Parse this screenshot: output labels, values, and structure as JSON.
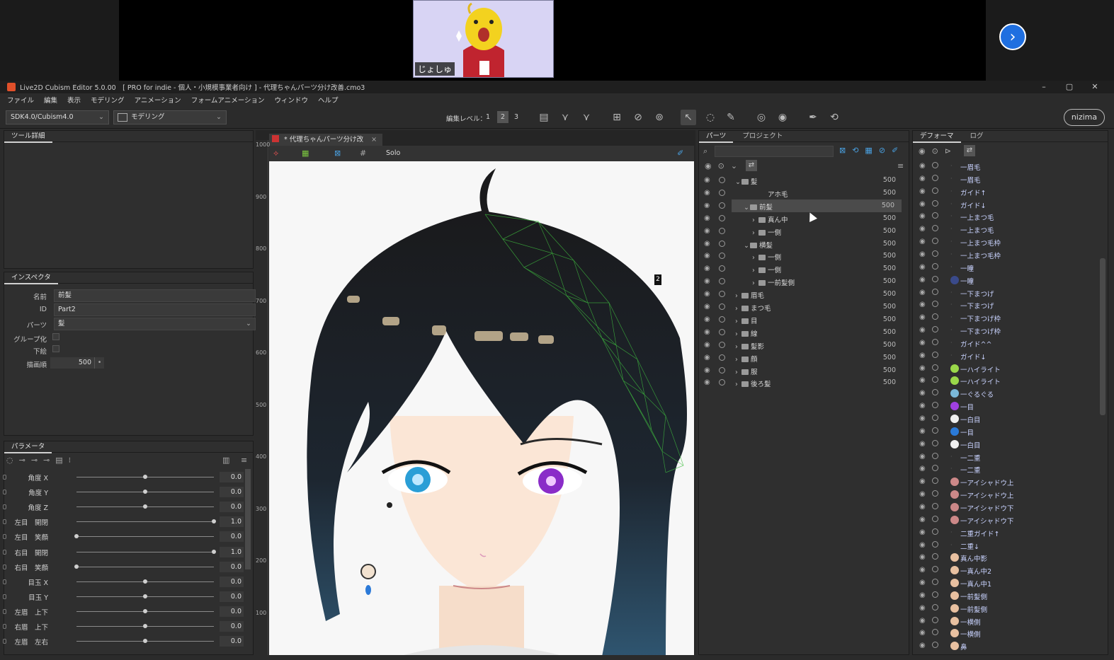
{
  "stream": {
    "webcam_name": "じょしゅ",
    "next_icon": "chevron-right-icon"
  },
  "window": {
    "title": "Live2D Cubism Editor 5.0.00　[ PRO for indie - 個人・小規模事業者向け ] - 代理ちゃんパーツ分け改善.cmo3",
    "minimize": "–",
    "restore": "▢",
    "close": "✕"
  },
  "menu": [
    "ファイル",
    "編集",
    "表示",
    "モデリング",
    "アニメーション",
    "フォームアニメーション",
    "ウィンドウ",
    "ヘルプ"
  ],
  "toolbar": {
    "sdk": "SDK4.0/Cubism4.0",
    "mode": "モデリング",
    "edit_level_label": "編集レベル：",
    "edit_levels": [
      "1",
      "2",
      "3"
    ],
    "edit_level_selected": "2",
    "brand": "nizima"
  },
  "tool_detail": {
    "tab": "ツール詳細"
  },
  "inspector": {
    "tab": "インスペクタ",
    "name_label": "名前",
    "name_value": "前髪",
    "id_label": "ID",
    "id_value": "Part2",
    "part_label": "パーツ",
    "part_value": "髪",
    "group_label": "グループ化",
    "sketch_label": "下絵",
    "order_label": "描画順",
    "order_value": "500"
  },
  "parameters": {
    "tab": "パラメータ",
    "rows": [
      {
        "label": "角度 X",
        "value": "0.0",
        "pos": 0.5
      },
      {
        "label": "角度 Y",
        "value": "0.0",
        "pos": 0.5
      },
      {
        "label": "角度 Z",
        "value": "0.0",
        "pos": 0.5
      },
      {
        "label": "左目　開閉",
        "value": "1.0",
        "pos": 1.0
      },
      {
        "label": "左目　笑顔",
        "value": "0.0",
        "pos": 0.0
      },
      {
        "label": "右目　開閉",
        "value": "1.0",
        "pos": 1.0
      },
      {
        "label": "右目　笑顔",
        "value": "0.0",
        "pos": 0.0
      },
      {
        "label": "目玉 X",
        "value": "0.0",
        "pos": 0.5
      },
      {
        "label": "目玉 Y",
        "value": "0.0",
        "pos": 0.5
      },
      {
        "label": "左眉　上下",
        "value": "0.0",
        "pos": 0.5
      },
      {
        "label": "右眉　上下",
        "value": "0.0",
        "pos": 0.5
      },
      {
        "label": "左眉　左右",
        "value": "0.0",
        "pos": 0.5
      }
    ]
  },
  "canvas": {
    "doc_tab": "* 代理ちゃんパーツ分け改",
    "doc_close": "×",
    "solo": "Solo",
    "ruler": [
      "1000",
      "900",
      "800",
      "700",
      "600",
      "500",
      "400",
      "300",
      "200",
      "100"
    ],
    "badge": "2"
  },
  "parts": {
    "tabs": [
      "パーツ",
      "プロジェクト"
    ],
    "rows": [
      {
        "name": "髪",
        "order": "500",
        "indent": 0,
        "open": true,
        "folder": true
      },
      {
        "name": "アホ毛",
        "order": "500",
        "indent": 2,
        "open": false,
        "folder": false
      },
      {
        "name": "前髪",
        "order": "500",
        "indent": 1,
        "open": true,
        "folder": true,
        "selected": true
      },
      {
        "name": "真ん中",
        "order": "500",
        "indent": 2,
        "open": false,
        "folder": true
      },
      {
        "name": "一側",
        "order": "500",
        "indent": 2,
        "open": false,
        "folder": true
      },
      {
        "name": "横髪",
        "order": "500",
        "indent": 1,
        "open": true,
        "folder": true
      },
      {
        "name": "一側",
        "order": "500",
        "indent": 2,
        "open": false,
        "folder": true
      },
      {
        "name": "一側",
        "order": "500",
        "indent": 2,
        "open": false,
        "folder": true
      },
      {
        "name": "一前髪側",
        "order": "500",
        "indent": 2,
        "open": false,
        "folder": true
      },
      {
        "name": "眉毛",
        "order": "500",
        "indent": 0,
        "open": false,
        "folder": true
      },
      {
        "name": "まつ毛",
        "order": "500",
        "indent": 0,
        "open": false,
        "folder": true
      },
      {
        "name": "目",
        "order": "500",
        "indent": 0,
        "open": false,
        "folder": true
      },
      {
        "name": "線",
        "order": "500",
        "indent": 0,
        "open": false,
        "folder": true
      },
      {
        "name": "髪影",
        "order": "500",
        "indent": 0,
        "open": false,
        "folder": true
      },
      {
        "name": "顔",
        "order": "500",
        "indent": 0,
        "open": false,
        "folder": true
      },
      {
        "name": "服",
        "order": "500",
        "indent": 0,
        "open": false,
        "folder": true
      },
      {
        "name": "後ろ髪",
        "order": "500",
        "indent": 0,
        "open": false,
        "folder": true
      }
    ]
  },
  "deformer": {
    "tabs": [
      "デフォーマ",
      "ログ"
    ],
    "rows": [
      {
        "name": "一眉毛",
        "color": ""
      },
      {
        "name": "一眉毛",
        "color": ""
      },
      {
        "name": "ガイド↑",
        "color": ""
      },
      {
        "name": "ガイド↓",
        "color": ""
      },
      {
        "name": "一上まつ毛",
        "color": ""
      },
      {
        "name": "一上まつ毛",
        "color": ""
      },
      {
        "name": "一上まつ毛枠",
        "color": ""
      },
      {
        "name": "一上まつ毛枠",
        "color": ""
      },
      {
        "name": "一瞳",
        "color": ""
      },
      {
        "name": "一瞳",
        "color": "#3a4a8a"
      },
      {
        "name": "一下まつげ",
        "color": ""
      },
      {
        "name": "一下まつげ",
        "color": ""
      },
      {
        "name": "一下まつげ枠",
        "color": ""
      },
      {
        "name": "一下まつげ枠",
        "color": ""
      },
      {
        "name": "ガイド^^",
        "color": ""
      },
      {
        "name": "ガイド↓",
        "color": ""
      },
      {
        "name": "一ハイライト",
        "color": "#9ad84a"
      },
      {
        "name": "一ハイライト",
        "color": "#9ad84a"
      },
      {
        "name": "一ぐるぐる",
        "color": "#7ab8d8"
      },
      {
        "name": "一目",
        "color": "#a040e0"
      },
      {
        "name": "一白目",
        "color": "#f0f0f0"
      },
      {
        "name": "一目",
        "color": "#2a7ad8"
      },
      {
        "name": "一白目",
        "color": "#f0f0f0"
      },
      {
        "name": "一二重",
        "color": ""
      },
      {
        "name": "一二重",
        "color": ""
      },
      {
        "name": "一アイシャドウ上",
        "color": "#c88"
      },
      {
        "name": "一アイシャドウ上",
        "color": "#c88"
      },
      {
        "name": "一アイシャドウ下",
        "color": "#c88"
      },
      {
        "name": "一アイシャドウ下",
        "color": "#c88"
      },
      {
        "name": "二重ガイド↑",
        "color": ""
      },
      {
        "name": "二重↓",
        "color": ""
      },
      {
        "name": "真ん中影",
        "color": "#e8c0a0"
      },
      {
        "name": "一真ん中2",
        "color": "#e8c0a0"
      },
      {
        "name": "一真ん中1",
        "color": "#e8c0a0"
      },
      {
        "name": "一前髪側",
        "color": "#e8c0a0"
      },
      {
        "name": "一前髪側",
        "color": "#e8c0a0"
      },
      {
        "name": "一横側",
        "color": "#e8c0a0"
      },
      {
        "name": "一横側",
        "color": "#e8c0a0"
      },
      {
        "name": "鼻",
        "color": "#e8c0a0"
      }
    ]
  },
  "colors": {
    "accent": "#1f6fe0",
    "mesh": "#3fbf3f",
    "panel": "#2f2f2f"
  }
}
